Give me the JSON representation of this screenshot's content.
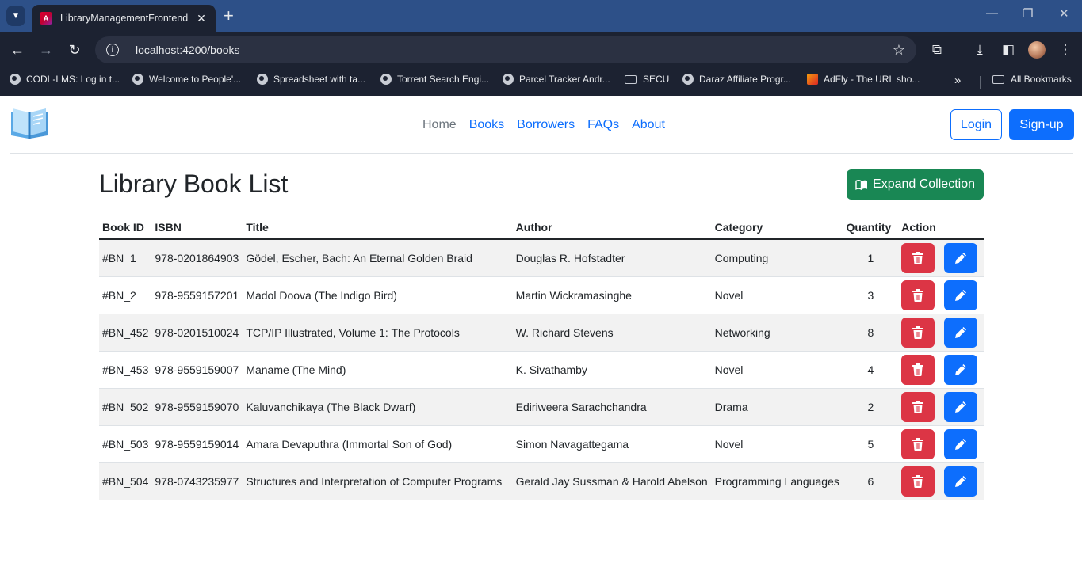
{
  "browser": {
    "tab_title": "LibraryManagementFrontend",
    "url": "localhost:4200/books",
    "bookmarks": [
      {
        "label": "CODL-LMS: Log in t..."
      },
      {
        "label": "Welcome to People'..."
      },
      {
        "label": "Spreadsheet with ta..."
      },
      {
        "label": "Torrent Search Engi..."
      },
      {
        "label": "Parcel Tracker Andr..."
      },
      {
        "label": "SECU"
      },
      {
        "label": "Daraz Affiliate Progr..."
      },
      {
        "label": "AdFly - The URL sho..."
      }
    ],
    "all_bookmarks": "All Bookmarks"
  },
  "nav": {
    "links": [
      "Home",
      "Books",
      "Borrowers",
      "FAQs",
      "About"
    ],
    "active": "Home",
    "login": "Login",
    "signup": "Sign-up"
  },
  "page": {
    "title": "Library Book List",
    "expand_button": "Expand Collection"
  },
  "table": {
    "headers": [
      "Book ID",
      "ISBN",
      "Title",
      "Author",
      "Category",
      "Quantity",
      "Action"
    ],
    "rows": [
      {
        "id": "#BN_1",
        "isbn": "978-0201864903",
        "title": "Gödel, Escher, Bach: An Eternal Golden Braid",
        "author": "Douglas R. Hofstadter",
        "category": "Computing",
        "qty": "1"
      },
      {
        "id": "#BN_2",
        "isbn": "978-9559157201",
        "title": "Madol Doova (The Indigo Bird)",
        "author": "Martin Wickramasinghe",
        "category": "Novel",
        "qty": "3"
      },
      {
        "id": "#BN_452",
        "isbn": "978-0201510024",
        "title": "TCP/IP Illustrated, Volume 1: The Protocols",
        "author": "W. Richard Stevens",
        "category": "Networking",
        "qty": "8"
      },
      {
        "id": "#BN_453",
        "isbn": "978-9559159007",
        "title": "Maname (The Mind)",
        "author": "K. Sivathamby",
        "category": "Novel",
        "qty": "4"
      },
      {
        "id": "#BN_502",
        "isbn": "978-9559159070",
        "title": "Kaluvanchikaya (The Black Dwarf)",
        "author": "Ediriweera Sarachchandra",
        "category": "Drama",
        "qty": "2"
      },
      {
        "id": "#BN_503",
        "isbn": "978-9559159014",
        "title": "Amara Devaputhra (Immortal Son of God)",
        "author": "Simon Navagattegama",
        "category": "Novel",
        "qty": "5"
      },
      {
        "id": "#BN_504",
        "isbn": "978-0743235977",
        "title": "Structures and Interpretation of Computer Programs",
        "author": "Gerald Jay Sussman & Harold Abelson",
        "category": "Programming Languages",
        "qty": "6"
      }
    ]
  },
  "colors": {
    "primary": "#0d6efd",
    "success": "#198754",
    "danger": "#dc3545",
    "tabbar": "#2d5088",
    "chrome": "#1c2231"
  }
}
